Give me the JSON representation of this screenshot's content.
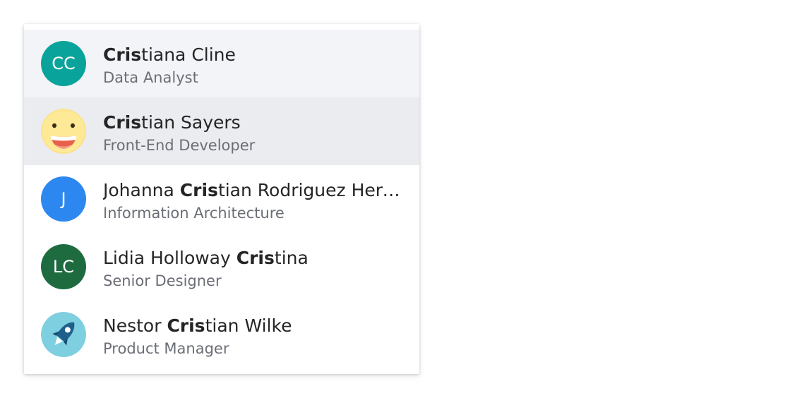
{
  "people": [
    {
      "initials": "CC",
      "avatar_color": "#0aa39b",
      "name_pre": "",
      "name_match": "Cris",
      "name_post": "tiana Cline",
      "role": "Data Analyst",
      "state": "hovered"
    },
    {
      "initials": "",
      "avatar_icon": "smiley-face-icon",
      "name_pre": "",
      "name_match": "Cris",
      "name_post": "tian Sayers",
      "role": "Front-End Developer",
      "state": "selected"
    },
    {
      "initials": "J",
      "avatar_color": "#2d87f0",
      "name_pre": "Johanna ",
      "name_match": "Cris",
      "name_post": "tian Rodriguez Hernández",
      "role": "Information Architecture",
      "state": "normal"
    },
    {
      "initials": "LC",
      "avatar_color": "#1d6b3f",
      "name_pre": "Lidia Holloway ",
      "name_match": "Cris",
      "name_post": "tina",
      "role": "Senior Designer",
      "state": "normal"
    },
    {
      "initials": "",
      "avatar_icon": "rocket-icon",
      "name_pre": "Nestor ",
      "name_match": "Cris",
      "name_post": "tian Wilke",
      "role": "Product Manager",
      "state": "normal"
    }
  ]
}
